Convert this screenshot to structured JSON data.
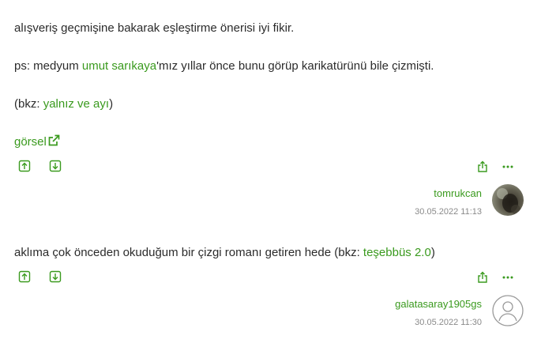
{
  "entry1": {
    "line1": "alışveriş geçmişine bakarak eşleştirme önerisi iyi fikir.",
    "line2_prefix": "ps: medyum ",
    "line2_link": "umut sarıkaya",
    "line2_suffix": "'mız yıllar önce bunu görüp karikatürünü bile çizmişti.",
    "line3_prefix": "(bkz: ",
    "line3_link": "yalnız ve ayı",
    "line3_suffix": ")",
    "image_link": "görsel",
    "author": "tomrukcan",
    "date": "30.05.2022 11:13"
  },
  "entry2": {
    "line1_prefix": "aklıma çok önceden okuduğum bir çizgi romanı getiren hede (bkz: ",
    "line1_link": "teşebbüs 2.0",
    "line1_suffix": ")",
    "author": "galatasaray1905gs",
    "date": "30.05.2022 11:30"
  },
  "icons": {
    "upvote": "upvote-icon",
    "downvote": "downvote-icon",
    "share": "share-icon",
    "more": "more-icon",
    "external": "external-link-icon"
  },
  "colors": {
    "accent": "#3a9a1e",
    "text": "#2b2b2b",
    "muted": "#8a8a8a"
  }
}
